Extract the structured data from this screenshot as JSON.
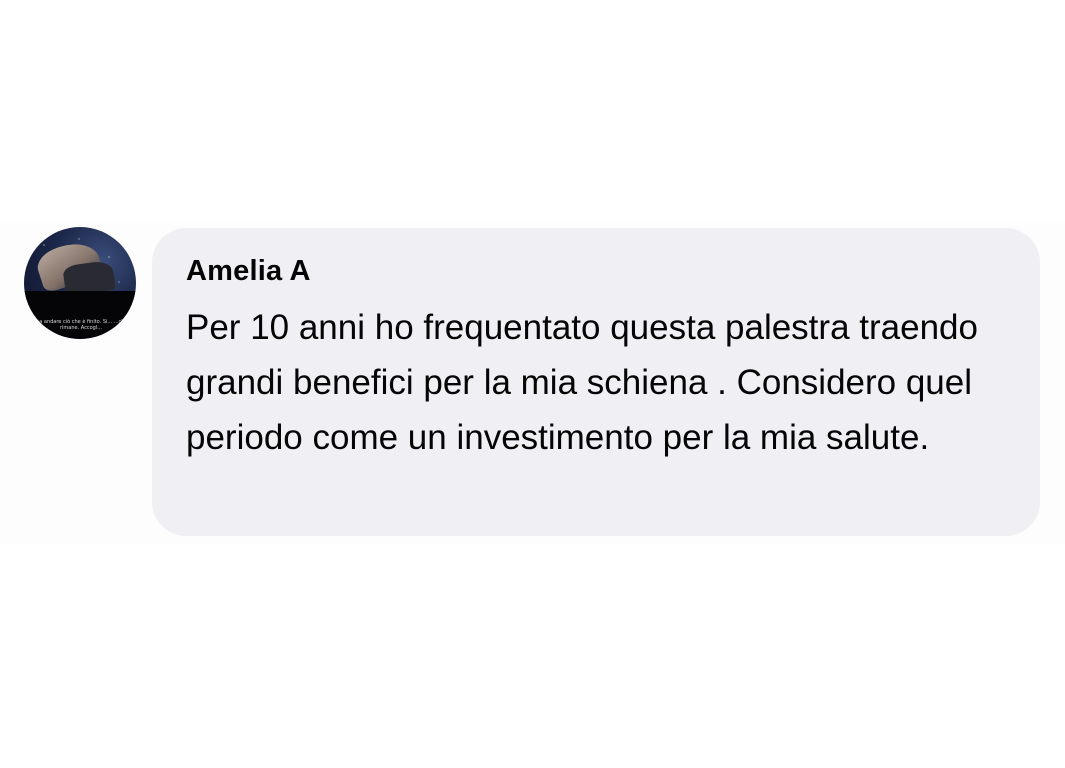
{
  "comment": {
    "author": "Amelia A",
    "text": "Per 10 anni ho frequentato questa palestra traendo grandi benefici per la mia schiena . Considero quel periodo come un investimento per la mia salute.",
    "avatar_caption": "...a andare ciò che è finito. Si... ...che rimane. Accogl..."
  },
  "colors": {
    "bubble_background": "#f0f0f4",
    "text": "#050505",
    "page_background": "#ffffff"
  }
}
